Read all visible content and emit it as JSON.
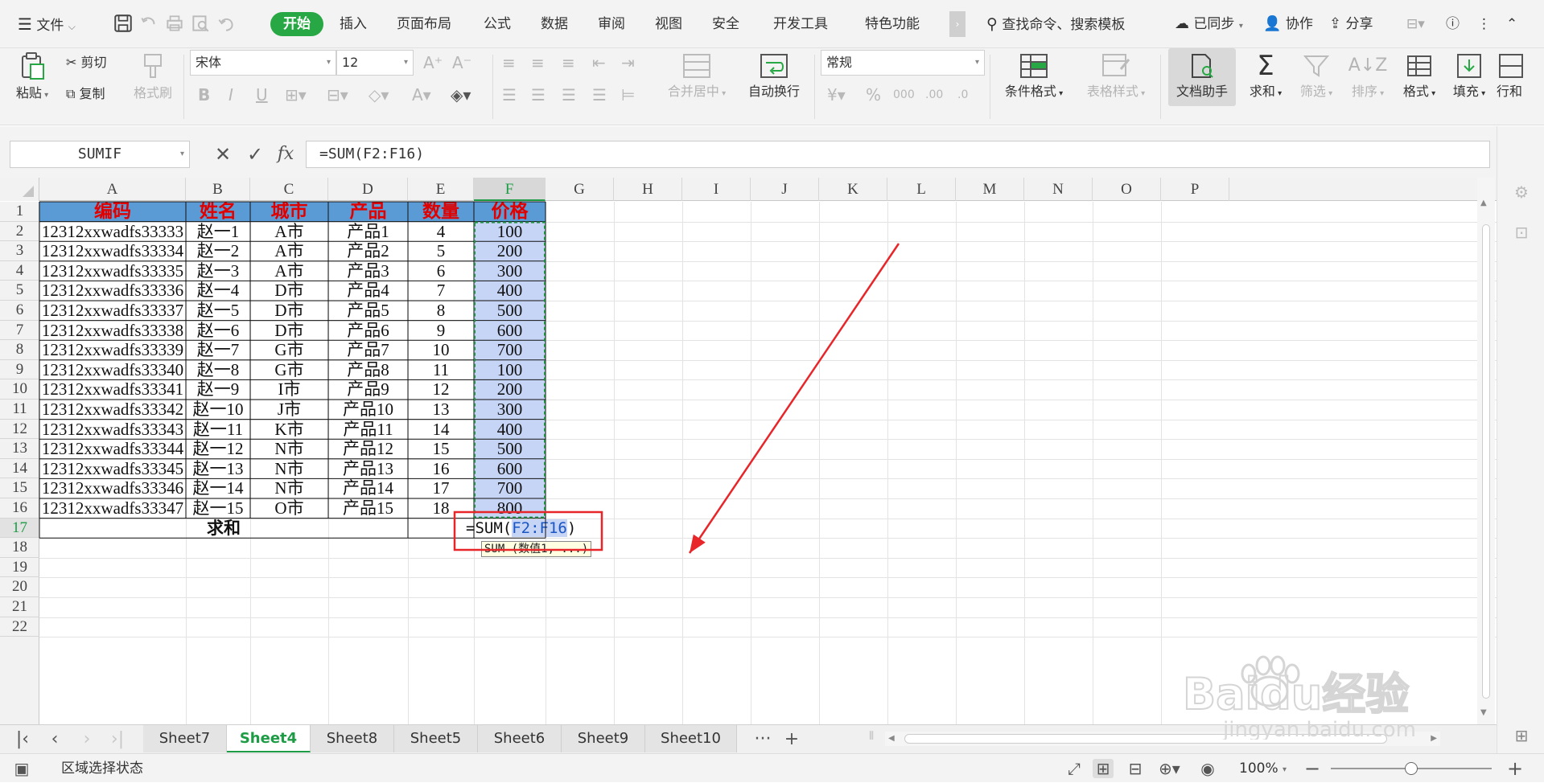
{
  "menubar": {
    "file_label": "文件",
    "tabs": [
      {
        "label": "开始",
        "active": true
      },
      {
        "label": "插入"
      },
      {
        "label": "页面布局"
      },
      {
        "label": "公式"
      },
      {
        "label": "数据"
      },
      {
        "label": "审阅"
      },
      {
        "label": "视图"
      },
      {
        "label": "安全"
      },
      {
        "label": "开发工具"
      },
      {
        "label": "特色功能"
      }
    ],
    "more_tabs": "›",
    "search_label": "查找命令、搜索模板",
    "sync_label": "已同步",
    "collab_label": "协作",
    "share_label": "分享",
    "accent_color": "#27a844"
  },
  "ribbon": {
    "paste": "粘贴",
    "cut": "剪切",
    "copy": "复制",
    "format_painter": "格式刷",
    "font_name": "宋体",
    "font_size": "12",
    "bold": "B",
    "italic": "I",
    "underline": "U",
    "merge_center": "合并居中",
    "wrap_text": "自动换行",
    "number_format": "常规",
    "conditional_format": "条件格式",
    "table_style": "表格样式",
    "doc_assistant": "文档助手",
    "sum": "求和",
    "filter": "筛选",
    "sort": "排序",
    "format": "格式",
    "fill": "填充",
    "row_col": "行和"
  },
  "formulabar": {
    "namebox": "SUMIF",
    "fx": "fx",
    "formula": "=SUM(F2:F16)"
  },
  "grid": {
    "columns": [
      "A",
      "B",
      "C",
      "D",
      "E",
      "F",
      "G",
      "H",
      "I",
      "J",
      "K",
      "L",
      "M",
      "N",
      "O",
      "P"
    ],
    "selected_column": "F",
    "rows": [
      "1",
      "2",
      "3",
      "4",
      "5",
      "6",
      "7",
      "8",
      "9",
      "10",
      "11",
      "12",
      "13",
      "14",
      "15",
      "16",
      "17",
      "18",
      "19",
      "20",
      "21",
      "22"
    ],
    "active_row": "17",
    "header": [
      "编码",
      "姓名",
      "城市",
      "产品",
      "数量",
      "价格"
    ],
    "header_color": "#5b9bd5",
    "header_text_color": "#e00000",
    "data": [
      [
        "12312xxwadfs33333",
        "赵一1",
        "A市",
        "产品1",
        "4",
        "100"
      ],
      [
        "12312xxwadfs33334",
        "赵一2",
        "A市",
        "产品2",
        "5",
        "200"
      ],
      [
        "12312xxwadfs33335",
        "赵一3",
        "A市",
        "产品3",
        "6",
        "300"
      ],
      [
        "12312xxwadfs33336",
        "赵一4",
        "D市",
        "产品4",
        "7",
        "400"
      ],
      [
        "12312xxwadfs33337",
        "赵一5",
        "D市",
        "产品5",
        "8",
        "500"
      ],
      [
        "12312xxwadfs33338",
        "赵一6",
        "D市",
        "产品6",
        "9",
        "600"
      ],
      [
        "12312xxwadfs33339",
        "赵一7",
        "G市",
        "产品7",
        "10",
        "700"
      ],
      [
        "12312xxwadfs33340",
        "赵一8",
        "G市",
        "产品8",
        "11",
        "100"
      ],
      [
        "12312xxwadfs33341",
        "赵一9",
        "I市",
        "产品9",
        "12",
        "200"
      ],
      [
        "12312xxwadfs33342",
        "赵一10",
        "J市",
        "产品10",
        "13",
        "300"
      ],
      [
        "12312xxwadfs33343",
        "赵一11",
        "K市",
        "产品11",
        "14",
        "400"
      ],
      [
        "12312xxwadfs33344",
        "赵一12",
        "N市",
        "产品12",
        "15",
        "500"
      ],
      [
        "12312xxwadfs33345",
        "赵一13",
        "N市",
        "产品13",
        "16",
        "600"
      ],
      [
        "12312xxwadfs33346",
        "赵一14",
        "N市",
        "产品14",
        "17",
        "700"
      ],
      [
        "12312xxwadfs33347",
        "赵一15",
        "O市",
        "产品15",
        "18",
        "800"
      ]
    ],
    "sum_label": "求和",
    "editing_cell": {
      "prefix": "=SUM(",
      "ref": "F2:F16",
      "suffix": ")"
    },
    "tooltip": "SUM (数值1, ...)",
    "selection_color": "#c6d4f5",
    "highlight_box_color": "#e8262a"
  },
  "sheets": {
    "tabs": [
      {
        "label": "Sheet7"
      },
      {
        "label": "Sheet4",
        "active": true
      },
      {
        "label": "Sheet8"
      },
      {
        "label": "Sheet5"
      },
      {
        "label": "Sheet6"
      },
      {
        "label": "Sheet9"
      },
      {
        "label": "Sheet10"
      }
    ],
    "more": "···",
    "add": "+"
  },
  "statusbar": {
    "mode": "区域选择状态",
    "zoom": "100%",
    "zoom_out": "−",
    "zoom_in": "+",
    "zoom_level": 0.5
  },
  "watermark": {
    "brand": "Baidu经验",
    "url": "jingyan.baidu.com"
  }
}
